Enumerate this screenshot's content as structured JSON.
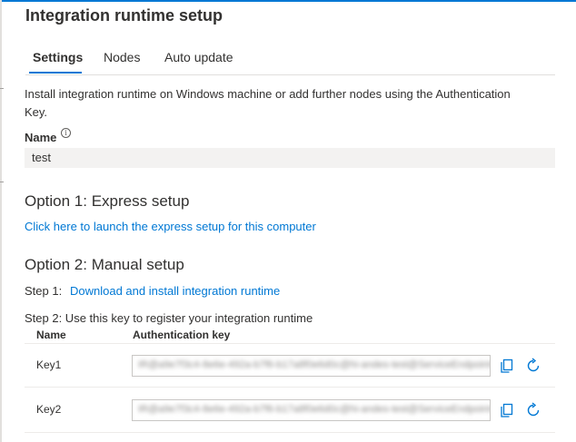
{
  "panel": {
    "title": "Integration runtime setup"
  },
  "tabs": [
    {
      "label": "Settings",
      "active": true
    },
    {
      "label": "Nodes",
      "active": false
    },
    {
      "label": "Auto update",
      "active": false
    }
  ],
  "settings": {
    "description": "Install integration runtime on Windows machine or add further nodes using the Authentication Key.",
    "name_label": "Name",
    "name_value": "test",
    "option1_heading": "Option 1: Express setup",
    "option1_link": "Click here to launch the express setup for this computer",
    "option2_heading": "Option 2: Manual setup",
    "step1_label": "Step 1:",
    "step1_link": "Download and install integration runtime",
    "step2_label": "Step 2: Use this key to register your integration runtime",
    "table": {
      "col_name": "Name",
      "col_key": "Authentication key",
      "rows": [
        {
          "name": "Key1",
          "key": "IR@a9e7f3c4-8e6e-492a-b7f6-b17a8f0e6d0c@hi-andes-test@ServiceEndpoint=hi-andes-test.eastus.datafactory.azure.net@Vr4m9kQ2"
        },
        {
          "name": "Key2",
          "key": "IR@a9e7f3c4-8e6e-492a-b7f6-b17a8f0e6d0c@hi-andes-test@ServiceEndpoint=hi-andes-test.eastus.datafactory.azure.net@Pz7c1xL8"
        }
      ]
    }
  },
  "colors": {
    "accent": "#0078d4",
    "text": "#323130",
    "field_bg": "#f3f2f1"
  },
  "icons": {
    "copy": "copy-icon",
    "refresh": "refresh-icon",
    "info": "info-icon"
  }
}
